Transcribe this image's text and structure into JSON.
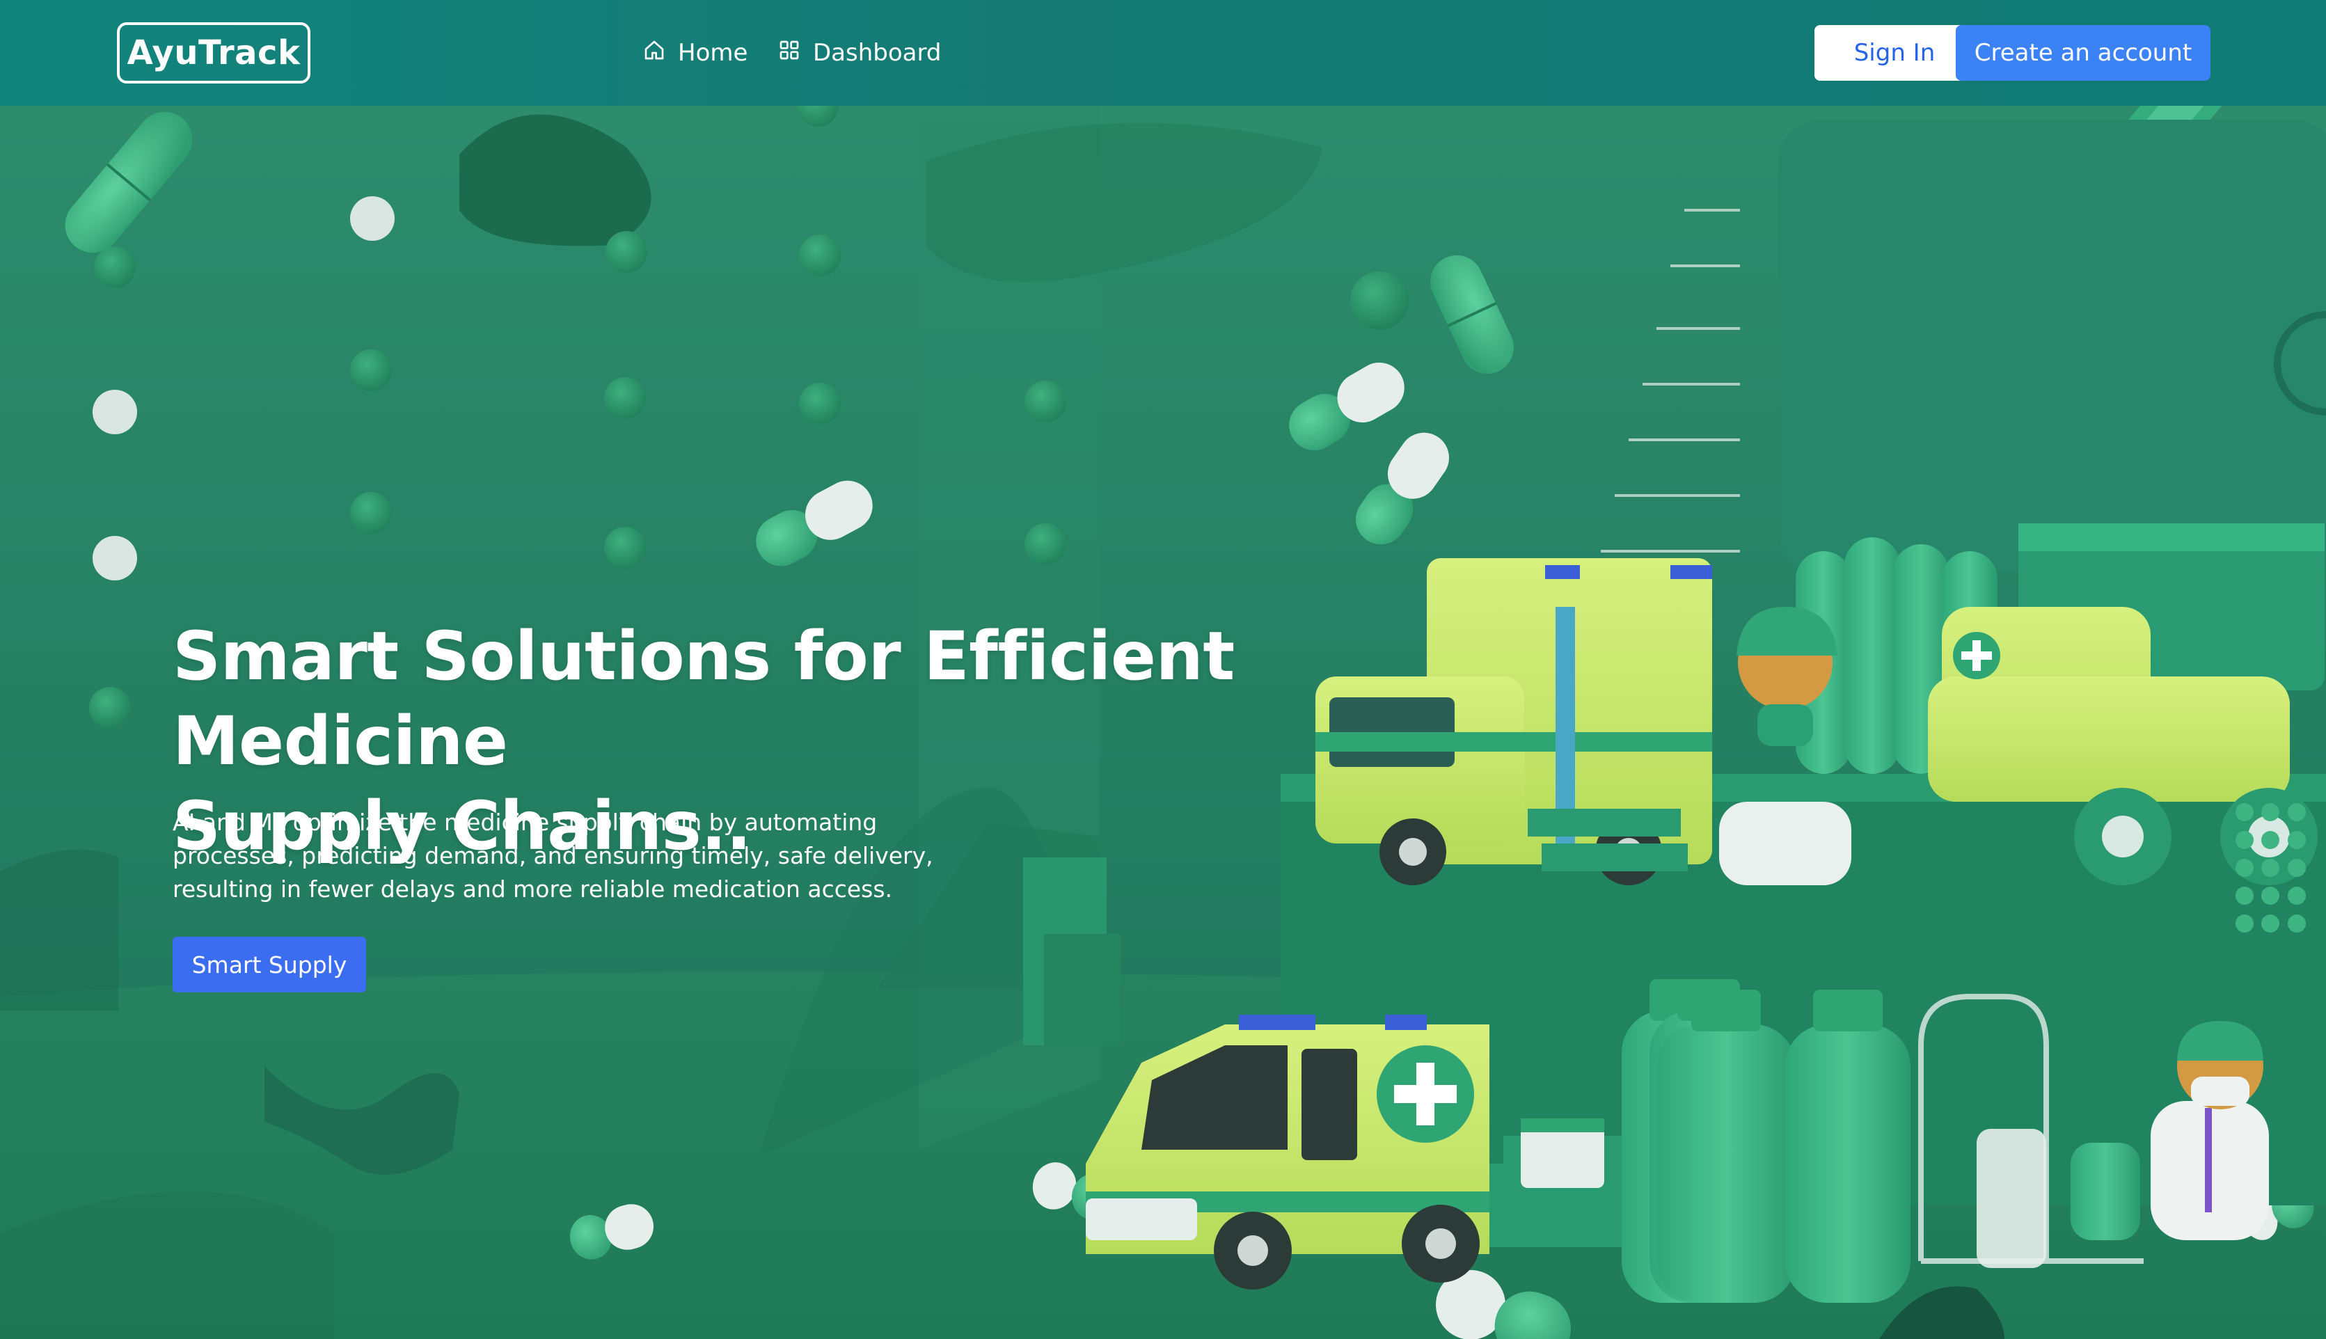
{
  "brand": {
    "logo_text": "AyuTrack"
  },
  "nav": {
    "links": [
      {
        "label": "Home",
        "icon": "home-icon"
      },
      {
        "label": "Dashboard",
        "icon": "dashboard-grid-icon"
      }
    ],
    "sign_in_label": "Sign In",
    "create_account_label": "Create an account"
  },
  "hero": {
    "title_line1": "Smart Solutions for Efficient Medicine",
    "title_line2": "Supply Chains..",
    "description_line1": "AI and ML optimize the medicine supply chain by automating",
    "description_line2": "processes, predicting demand, and ensuring timely, safe delivery,",
    "description_line3": "resulting in fewer delays and more reliable medication access.",
    "cta_label": "Smart Supply"
  },
  "colors": {
    "navbar": "#127d76",
    "hero_bg": "#24805f",
    "primary_button": "#3b82f6",
    "signin_text": "#2563eb",
    "ambulance_yellow": "#c8e86a"
  }
}
